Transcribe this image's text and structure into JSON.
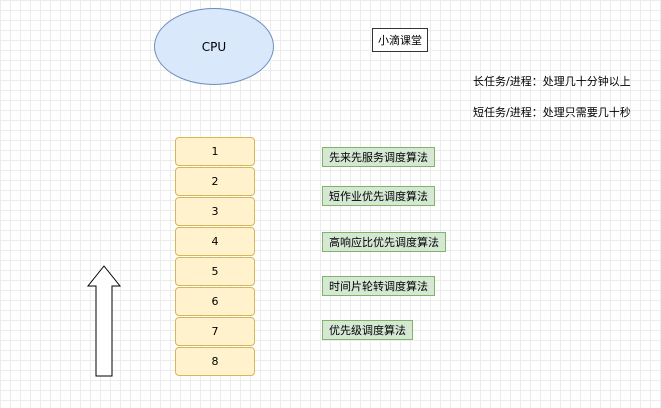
{
  "cpu": {
    "label": "CPU"
  },
  "title_tag": "小滴课堂",
  "notes": {
    "long": "长任务/进程：处理几十分钟以上",
    "short": "短任务/进程：处理只需要几十秒"
  },
  "queue": [
    "1",
    "2",
    "3",
    "4",
    "5",
    "6",
    "7",
    "8"
  ],
  "algorithms": [
    "先来先服务调度算法",
    "短作业优先调度算法",
    "高响应比优先调度算法",
    "时间片轮转调度算法",
    "优先级调度算法"
  ],
  "colors": {
    "cpu_fill": "#dae8fc",
    "queue_fill": "#fff2cc",
    "algorithm_fill": "#d5e8d4"
  }
}
